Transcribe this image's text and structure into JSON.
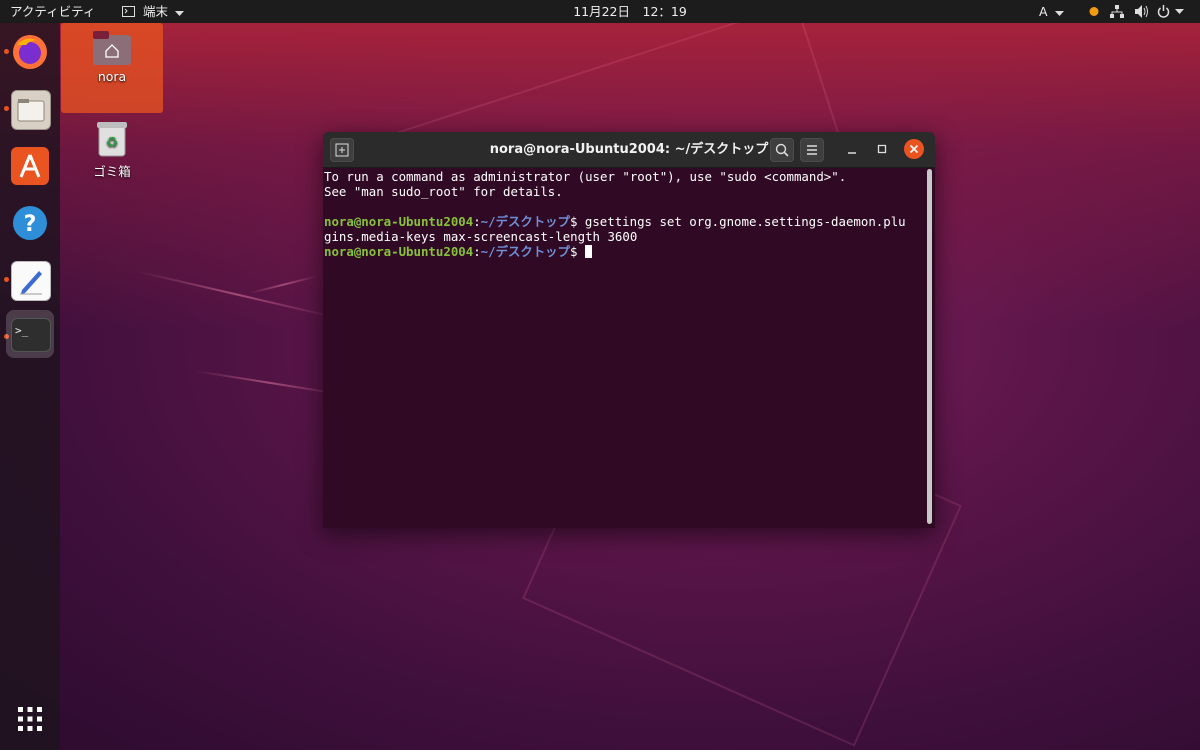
{
  "topbar": {
    "activities": "アクティビティ",
    "app_menu": "端末",
    "clock": "11月22日　12：19",
    "input_method": "A"
  },
  "dock": {
    "apps": [
      {
        "name": "firefox",
        "icon": "firefox-icon",
        "running": true,
        "active": false
      },
      {
        "name": "files",
        "icon": "files-icon",
        "running": true,
        "active": false
      },
      {
        "name": "software",
        "icon": "software-store-icon",
        "running": false,
        "active": false
      },
      {
        "name": "help",
        "icon": "help-icon",
        "running": false,
        "active": false
      },
      {
        "name": "text-editor",
        "icon": "text-editor-icon",
        "running": true,
        "active": false
      },
      {
        "name": "terminal",
        "icon": "terminal-icon",
        "running": true,
        "active": true
      }
    ],
    "show_apps_icon": "app-grid-icon"
  },
  "desktop": {
    "home_label": "nora",
    "trash_label": "ゴミ箱"
  },
  "terminal": {
    "title": "nora@nora-Ubuntu2004: ~/デスクトップ",
    "info_line1": "To run a command as administrator (user \"root\"), use \"sudo <command>\".",
    "info_line2": "See \"man sudo_root\" for details.",
    "prompt_user": "nora@nora-Ubuntu2004",
    "prompt_sep": ":",
    "prompt_path": "~/デスクトップ",
    "prompt_dollar": "$ ",
    "command_part1": "gsettings set org.gnome.settings-daemon.plu",
    "command_part2": "gins.media-keys max-screencast-length 3600"
  },
  "colors": {
    "accent": "#e95420",
    "terminal_bg": "#300a24",
    "prompt_user": "#87c23a",
    "prompt_path": "#6f8fd6"
  }
}
